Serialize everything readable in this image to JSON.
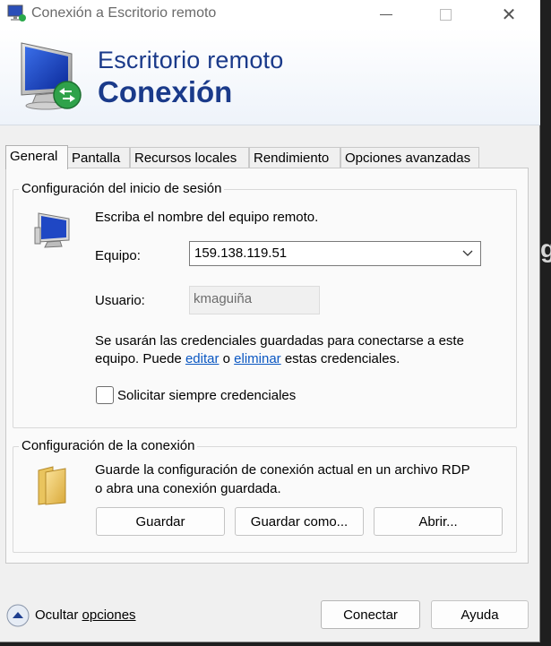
{
  "window": {
    "title": "Conexión a Escritorio remoto",
    "controls": {
      "minimize": "",
      "maximize": "",
      "close": "✕"
    }
  },
  "banner": {
    "line1": "Escritorio remoto",
    "line2": "Conexión"
  },
  "tabs": [
    {
      "label": "General",
      "active": true
    },
    {
      "label": "Pantalla",
      "active": false
    },
    {
      "label": "Recursos locales",
      "active": false
    },
    {
      "label": "Rendimiento",
      "active": false
    },
    {
      "label": "Opciones avanzadas",
      "active": false
    }
  ],
  "login_group": {
    "title": "Configuración del inicio de sesión",
    "prompt": "Escriba el nombre del equipo remoto.",
    "computer_label": "Equipo:",
    "computer_value": "159.138.119.51",
    "user_label": "Usuario:",
    "user_value": "kmaguiña",
    "saved_line1": "Se usarán las credenciales guardadas para conectarse a este",
    "saved_line2_prefix": "equipo.  Puede",
    "edit_link": "editar",
    "or_text": "o",
    "delete_link": "eliminar",
    "saved_line2_suffix": "estas credenciales.",
    "always_ask_label": "Solicitar siempre credenciales",
    "always_ask_checked": false
  },
  "connection_group": {
    "title": "Configuración de la conexión",
    "desc_line1": "Guarde la configuración de conexión actual en un archivo RDP",
    "desc_line2": "o abra una conexión guardada.",
    "save_button": "Guardar",
    "save_as_button": "Guardar como...",
    "open_button": "Abrir..."
  },
  "footer": {
    "toggle_label_prefix": "Ocultar ",
    "toggle_label_underlined": "opciones",
    "connect_button": "Conectar",
    "help_button": "Ayuda"
  },
  "background_fragment": "g",
  "colors": {
    "accent_text": "#1a3a8a",
    "link": "#0a57c2",
    "window_bg": "#f0f0f0",
    "panel_bg": "#fafafa"
  }
}
